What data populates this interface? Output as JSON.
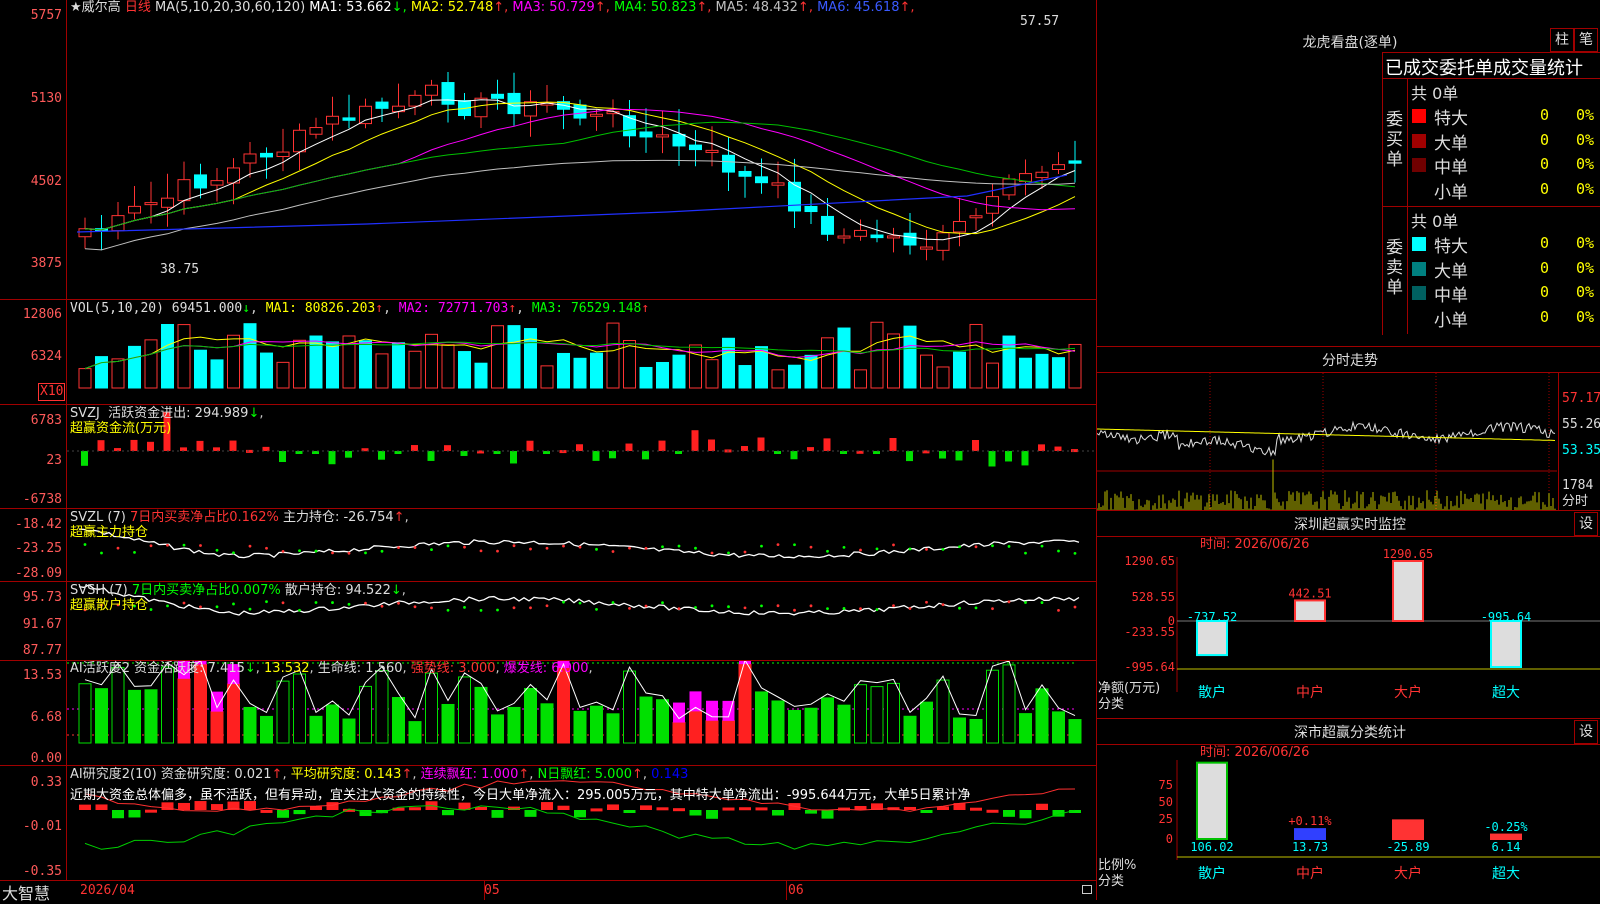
{
  "app": {
    "brand": "大智慧"
  },
  "main": {
    "title_prefix": "★",
    "stock_name": "威尔高",
    "period": "日线",
    "ma_label": "MA(5,10,20,30,60,120)",
    "ma": [
      {
        "label": "MA1: 53.662",
        "arrow": "↓",
        "color": "#ffffff"
      },
      {
        "label": "MA2: 52.748",
        "arrow": "↑",
        "color": "#ffff00"
      },
      {
        "label": "MA3: 50.729",
        "arrow": "↑",
        "color": "#ff00ff"
      },
      {
        "label": "MA4: 50.823",
        "arrow": "↑",
        "color": "#00ff00"
      },
      {
        "label": "MA5: 48.432",
        "arrow": "↑",
        "color": "#c0c0c0"
      },
      {
        "label": "MA6: 45.618",
        "arrow": "↑",
        "color": "#0000ff"
      }
    ],
    "yaxis": [
      "5757",
      "5130",
      "4502",
      "3875"
    ],
    "high_label": "57.57",
    "low_label": "38.75"
  },
  "vol": {
    "label": "VOL(5,10,20)",
    "value": "69451.000",
    "ma1": "MA1: 80826.203",
    "ma2": "MA2: 72771.703",
    "ma3": "MA3: 76529.148",
    "yaxis": [
      "12806",
      "6324"
    ],
    "unit": "X10"
  },
  "svzj": {
    "name": "SVZJ",
    "label": "活跃资金进出: 294.989",
    "arrow": "↓",
    "sub": "超赢资金流(万元)",
    "yaxis": [
      "6783",
      "23",
      "-6738"
    ]
  },
  "svzl": {
    "name": "SVZL (7)",
    "pct": "7日内买卖净占比0.162%",
    "hold": "主力持仓: -26.754",
    "arrow": "↑",
    "sub": "超赢主力持仓",
    "yaxis": [
      "-18.42",
      "-23.25",
      "-28.09"
    ]
  },
  "svsh": {
    "name": "SVSH (7)",
    "pct": "7日内买卖净占比0.007%",
    "hold": "散户持仓: 94.522",
    "arrow": "↓",
    "sub": "超赢散户持仓",
    "yaxis": [
      "95.73",
      "91.67",
      "87.77"
    ]
  },
  "ai1": {
    "label": "AI活跃度2 资金活跃度: 7.415",
    "v2": "13.532",
    "v3": "生命线: 1.560",
    "v4": "强势线: 3.000",
    "v5": "爆发线: 6.000",
    "yaxis": [
      "13.53",
      "6.68",
      "0.00"
    ]
  },
  "ai2": {
    "label": "AI研究度2(10) 资金研究度: 0.021",
    "avg": "平均研究度: 0.143",
    "red": "连续飘红: 1.000",
    "nred": "N日飘红: 5.000",
    "last": "0.143",
    "comment": "近期大资金总体偏多，虽不活跃，但有异动，宜关注大资金的持续性，今日大单净流入：295.005万元，其中特大单净流出：-995.644万元，大单5日累计净",
    "yaxis": [
      "0.33",
      "-0.01",
      "-0.35"
    ]
  },
  "xaxis": {
    "d1": "2026/04",
    "d2": "05",
    "d3": "06"
  },
  "right": {
    "lhb_title": "龙虎看盘(逐单)",
    "btn_bar": "柱",
    "btn_pen": "笔",
    "stat_title": "已成交委托单成交量统计",
    "buy_label": "委买单",
    "sell_label": "委卖单",
    "buy_total": "共 0单",
    "sell_total": "共 0单",
    "buy_rows": [
      {
        "name": "特大",
        "count": "0",
        "pct": "0%",
        "color": "#ff0000"
      },
      {
        "name": "大单",
        "count": "0",
        "pct": "0%",
        "color": "#a00000"
      },
      {
        "name": "中单",
        "count": "0",
        "pct": "0%",
        "color": "#700000"
      },
      {
        "name": "小单",
        "count": "0",
        "pct": "0%",
        "color": "#000000"
      }
    ],
    "sell_rows": [
      {
        "name": "特大",
        "count": "0",
        "pct": "0%",
        "color": "#00ffff"
      },
      {
        "name": "大单",
        "count": "0",
        "pct": "0%",
        "color": "#008080"
      },
      {
        "name": "中单",
        "count": "0",
        "pct": "0%",
        "color": "#006060"
      },
      {
        "name": "小单",
        "count": "0",
        "pct": "0%",
        "color": "#000000"
      }
    ],
    "intraday_title": "分时走势",
    "intraday_axis": [
      "57.17",
      "55.26",
      "53.35",
      "1784",
      "分时"
    ],
    "monitor_title": "深圳超赢实时监控",
    "settings": "设",
    "date1": "时间: 2026/06/26",
    "monitor_axis": [
      "1290.65",
      "528.55",
      "0",
      "-233.55",
      "-995.64"
    ],
    "monitor_values": [
      "-737.52",
      "442.51",
      "1290.65",
      "-995.64"
    ],
    "monitor_ylabel1": "净额(万元)",
    "monitor_ylabel2": "分类",
    "categories": [
      "散户",
      "中户",
      "大户",
      "超大"
    ],
    "class_title": "深市超赢分类统计",
    "date2": "时间: 2026/06/26",
    "class_axis": [
      "75",
      "50",
      "25",
      "0"
    ],
    "class_pcts": [
      "+0.11%",
      "-0.25%"
    ],
    "class_values": [
      "106.02",
      "13.73",
      "-25.89",
      "6.14"
    ],
    "class_ylabel1": "比例%",
    "class_ylabel2": "分类"
  }
}
